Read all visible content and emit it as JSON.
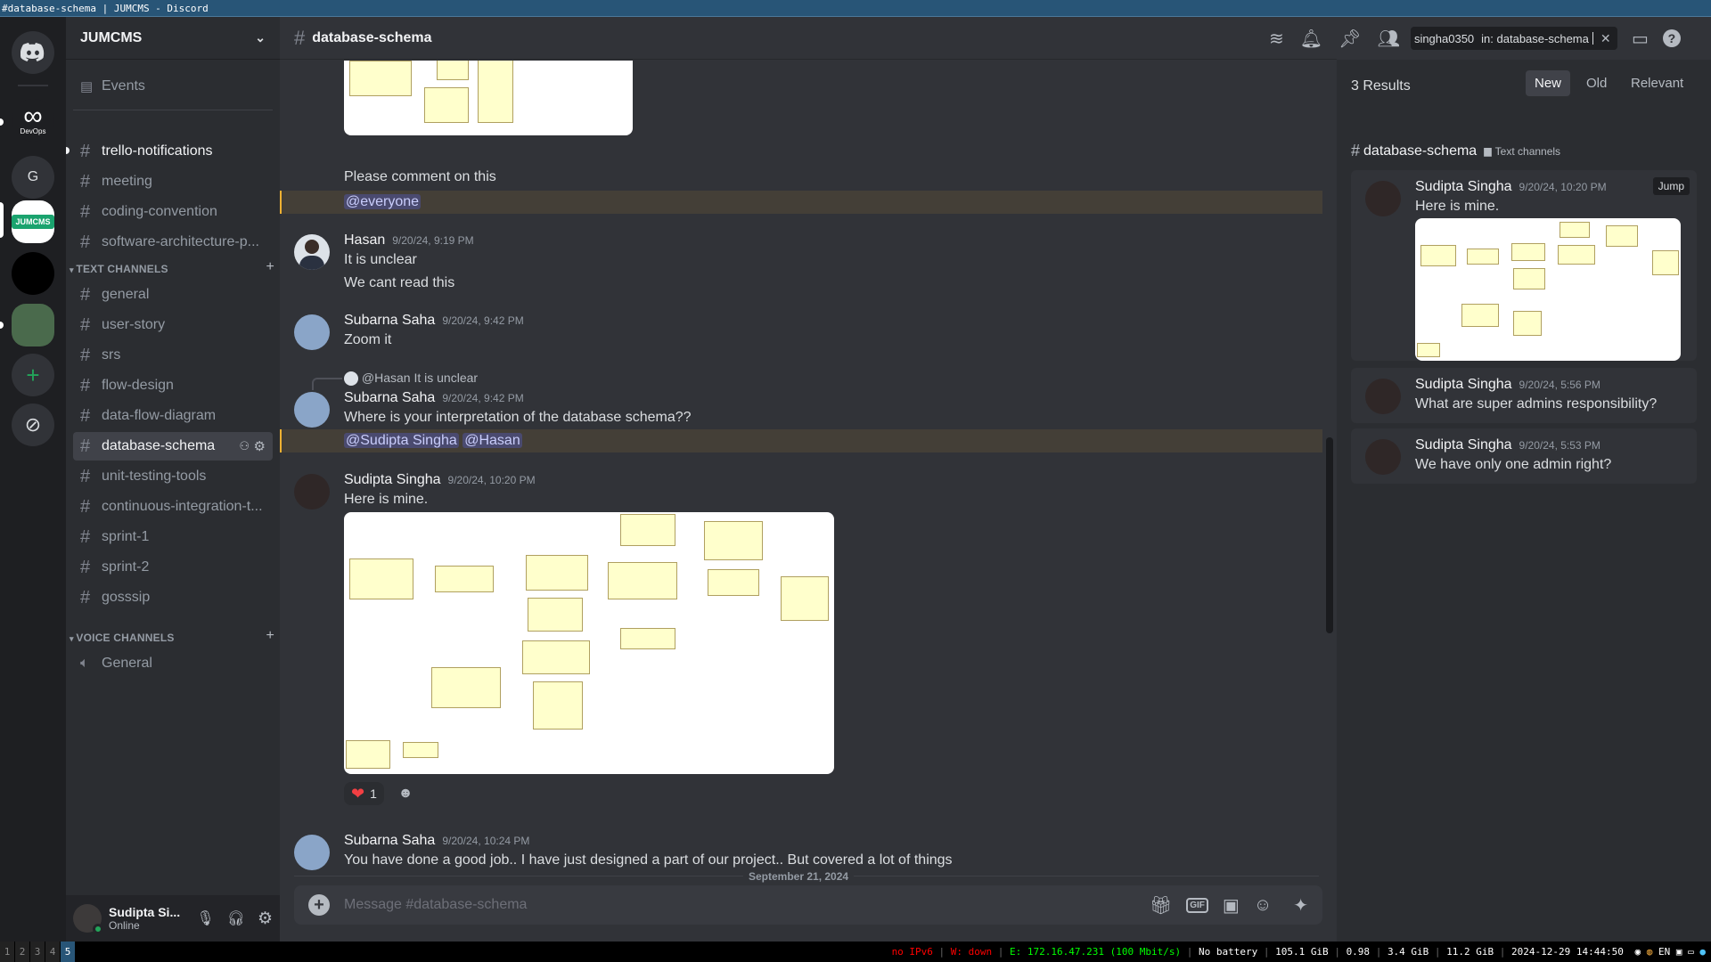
{
  "window_title": "#database-schema | JUMCMS - Discord",
  "servers": {
    "items": [
      {
        "label": "DevOps",
        "icon": "infinity-icon"
      },
      {
        "label": "G"
      },
      {
        "label": "JUMCMS"
      },
      {
        "label": ""
      },
      {
        "label": ""
      }
    ]
  },
  "guild": {
    "name": "JUMCMS"
  },
  "sidebar": {
    "events_label": "Events",
    "top_channels": [
      "trello-notifications",
      "meeting",
      "coding-convention",
      "software-architecture-p..."
    ],
    "text_category": "TEXT CHANNELS",
    "text_channels": [
      "general",
      "user-story",
      "srs",
      "flow-design",
      "data-flow-diagram",
      "database-schema",
      "unit-testing-tools",
      "continuous-integration-t...",
      "sprint-1",
      "sprint-2",
      "gosssip"
    ],
    "voice_category": "VOICE CHANNELS",
    "voice_channels": [
      "General"
    ]
  },
  "user": {
    "name": "Sudipta Si...",
    "status": "Online"
  },
  "chat": {
    "channel": "database-schema",
    "messages": {
      "m0_text": "Please comment on this",
      "m0_mention": "@everyone",
      "m1_author": "Hasan",
      "m1_time": "9/20/24, 9:19 PM",
      "m1_line1": "It is unclear",
      "m1_line2": "We cant read this",
      "m2_author": "Subarna Saha",
      "m2_time": "9/20/24, 9:42 PM",
      "m2_text": "Zoom it",
      "m3_reply_author": "@Hasan",
      "m3_reply_text": "It is unclear",
      "m3_author": "Subarna Saha",
      "m3_time": "9/20/24, 9:42 PM",
      "m3_text": "Where is your interpretation of the database schema??",
      "m3_mention1": "@Sudipta Singha",
      "m3_mention2": "@Hasan",
      "m4_author": "Sudipta Singha",
      "m4_time": "9/20/24, 10:20 PM",
      "m4_text": "Here is mine.",
      "m4_reaction_count": "1",
      "m5_author": "Subarna Saha",
      "m5_time": "9/20/24, 10:24 PM",
      "m5_text": "You have done a good job.. I have just designed a part of our project.. But covered a lot of things"
    },
    "date_divider": "September 21, 2024",
    "composer_placeholder": "Message #database-schema"
  },
  "search": {
    "query_user": "singha0350",
    "query_in": "in: database-schema",
    "results_count": "3 Results",
    "sort_new": "New",
    "sort_old": "Old",
    "sort_relevant": "Relevant",
    "channel": "database-schema",
    "channel_category": "Text channels",
    "jump_label": "Jump",
    "results": [
      {
        "author": "Sudipta Singha",
        "time": "9/20/24, 10:20 PM",
        "text": "Here is mine."
      },
      {
        "author": "Sudipta Singha",
        "time": "9/20/24, 5:56 PM",
        "text": "What are super admins responsibility?"
      },
      {
        "author": "Sudipta Singha",
        "time": "9/20/24, 5:53 PM",
        "text": "We have only one admin right?"
      }
    ]
  },
  "statusbar": {
    "workspaces": [
      "1",
      "2",
      "3",
      "4",
      "5"
    ],
    "current_workspace": "5",
    "ipv6": "no IPv6",
    "wifi": "W: down",
    "eth": "E: 172.16.47.231 (100 Mbit/s)",
    "battery": "No battery",
    "disk": "105.1 GiB",
    "load": "0.98",
    "mem": "3.4 GiB",
    "swap": "11.2 GiB",
    "datetime": "2024-12-29 14:44:50",
    "lang": "EN"
  },
  "colors": {
    "accent": "#5865f2",
    "online": "#23a55a",
    "mention_bg": "#f0b132",
    "heart": "#f23f43"
  }
}
